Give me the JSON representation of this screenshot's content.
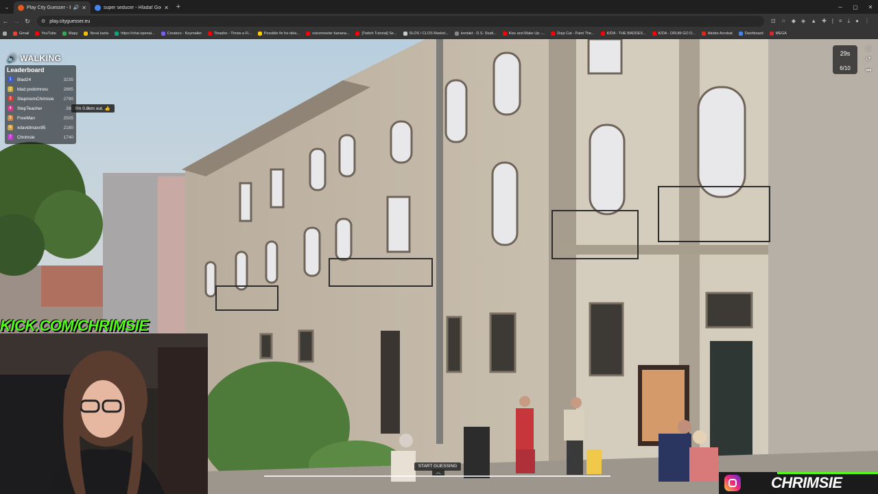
{
  "browser": {
    "tabs": [
      {
        "title": "Play City Guesser - Explore",
        "favicon_color": "#e25a1c",
        "active": true
      },
      {
        "title": "super seducer - Hľadať Googl",
        "favicon_color": "#4285f4",
        "active": false
      }
    ],
    "url": "play.cityguesser.eu",
    "bookmarks": [
      {
        "label": "Gmail",
        "color": "#ea4335"
      },
      {
        "label": "YouTube",
        "color": "#ff0000"
      },
      {
        "label": "Mapy",
        "color": "#34a853"
      },
      {
        "label": "Nová karta",
        "color": "#fbbc05"
      },
      {
        "label": "https://chat.openai...",
        "color": "#10a37f"
      },
      {
        "label": "Creators - Keymailer",
        "color": "#7a5cff"
      },
      {
        "label": "Tinashe - Throw a Fi...",
        "color": "#ff0000"
      },
      {
        "label": "Possible fix for dela...",
        "color": "#ffcc00"
      },
      {
        "label": "voicemeeter banana...",
        "color": "#ff0000"
      },
      {
        "label": "[Twitch Tutorial] Se...",
        "color": "#ff0000"
      },
      {
        "label": "SLOS / CLOS Market...",
        "color": "#cccccc"
      },
      {
        "label": "kontakt - D.S. Studi...",
        "color": "#888888"
      },
      {
        "label": "Kiss and Make Up -...",
        "color": "#ff0000"
      },
      {
        "label": "Doja Cat - Paint The...",
        "color": "#ff0000"
      },
      {
        "label": "K/DA - THE BADDES...",
        "color": "#ff0000"
      },
      {
        "label": "K/DA - DRUM GO D...",
        "color": "#ff0000"
      },
      {
        "label": "Adobe Acrobat",
        "color": "#e3261c"
      },
      {
        "label": "Dashboard",
        "color": "#4285f4"
      },
      {
        "label": "MEGA",
        "color": "#d9272e"
      }
    ]
  },
  "game": {
    "walking_label": "WALKING",
    "leaderboard_title": "Leaderboard",
    "leaderboard": [
      {
        "rank": "1",
        "name": "Blad24",
        "score": "3235",
        "color": "#3b5bd6"
      },
      {
        "rank": "2",
        "name": "blad podomnou",
        "score": "2885",
        "color": "#d6b03b"
      },
      {
        "rank": "3",
        "name": "StepmomChrimsie",
        "score": "2790",
        "color": "#d63b3b"
      },
      {
        "rank": "4",
        "name": "StepTeacher",
        "score": "260",
        "color": "#d63b8a"
      },
      {
        "rank": "5",
        "name": "FreeMan",
        "score": "2505",
        "color": "#d68a3b"
      },
      {
        "rank": "6",
        "name": "xdavidmaxx95",
        "score": "2180",
        "color": "#d6a03b"
      },
      {
        "rank": "7",
        "name": "Chrimsie",
        "score": "1740",
        "color": "#c63bd6"
      }
    ],
    "chat_message": "I'm 0.8km out.",
    "timer": "29s",
    "round": "6/10",
    "start_guessing": "START GUESSING"
  },
  "stream": {
    "kick_handle": "KICK.COM/CHRIMSIE",
    "social_handle": "CHRIMSIE",
    "accent": "#53fc18"
  }
}
